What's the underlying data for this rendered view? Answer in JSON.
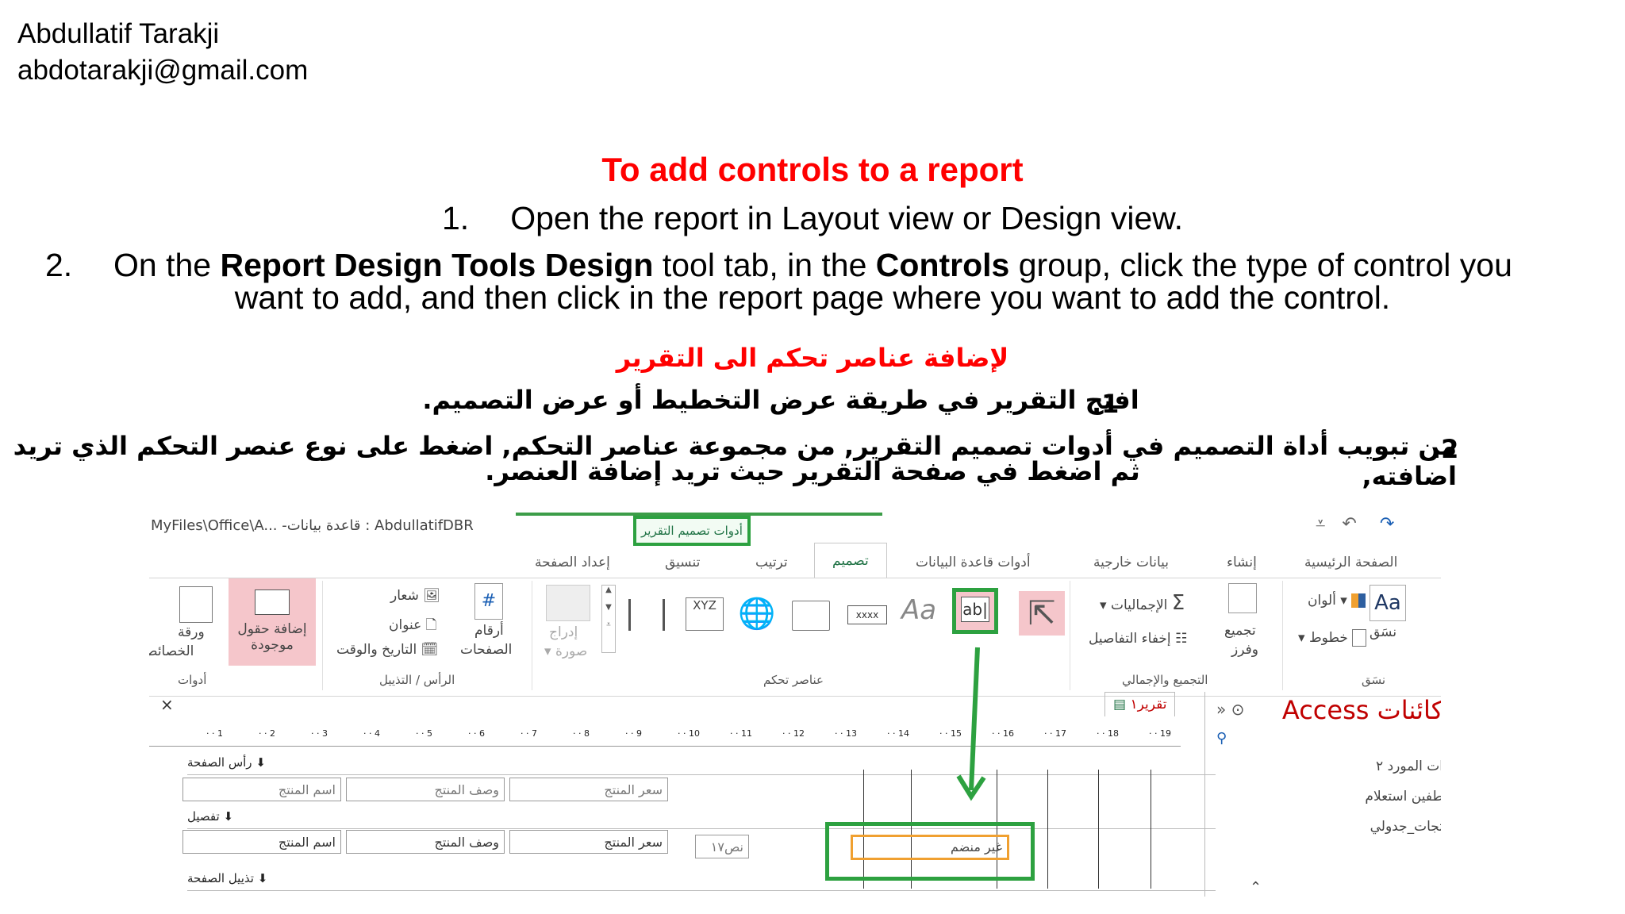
{
  "author": {
    "name": "Abdullatif Tarakji",
    "email": "abdotarakji@gmail.com"
  },
  "english": {
    "title": "To add controls to a report",
    "step1_num": "1.",
    "step1_text": "Open the report in Layout view or Design view.",
    "step2_num": "2.",
    "step2_part1": "On the ",
    "step2_bold1": "Report Design Tools Design",
    "step2_part2": " tool tab, in the ",
    "step2_bold2": "Controls",
    "step2_part3": " group, click the type of control you",
    "step2_line2": "want to add, and then click in the report page where you want to add the control."
  },
  "arabic": {
    "title": "لإضافة عناصر تحكم الى التقرير",
    "step1_num": ".1",
    "step1_text": "افتح التقرير في طريقة عرض التخطيط أو عرض التصميم.",
    "step2_num": ".2",
    "step2_line1": "من تبويب أداة التصميم في أدوات تصميم التقرير, من مجموعة عناصر التحكم, اضغط على نوع عنصر التحكم الذي تريد اضافته,",
    "step2_line2": "ثم اضغط في صفحة التقرير حيث تريد إضافة العنصر."
  },
  "screenshot": {
    "window_title": "MyFiles\\Office\\A... -قاعدة بيانات : AbdullatifDBR",
    "context_tab": "أدوات تصميم التقرير",
    "tabs": [
      "الصفحة الرئيسية",
      "إنشاء",
      "بيانات خارجية",
      "أدوات قاعدة البيانات",
      "تصميم",
      "ترتيب",
      "تنسيق",
      "إعداد الصفحة"
    ],
    "active_tab": "تصميم",
    "groups": {
      "themes": "نسَق",
      "grouping": "التجميع والإجمالي",
      "controls": "عناصر تحكم",
      "header_footer": "الرأس / التذييل",
      "tools": "أدوات"
    },
    "buttons": {
      "themes": "نسَق",
      "colors": "ألوان",
      "fonts": "خطوط",
      "group_sort_1": "تجميع",
      "group_sort_2": "وفرز",
      "totals": "الإجماليات",
      "hide_details": "إخفاء التفاصيل",
      "insert_image_1": "إدراج",
      "insert_image_2": "صورة",
      "page_numbers_1": "أرقام",
      "page_numbers_2": "الصفحات",
      "logo": "شعار",
      "title": "عنوان",
      "date_time": "التاريخ والوقت",
      "add_fields_1": "إضافة حقول",
      "add_fields_2": "موجودة",
      "property_sheet_1": "ورقة",
      "property_sheet_2": "الخصائص",
      "label_control": "Aa",
      "textbox_control": "ab|",
      "xyz": "XYZ",
      "xxxx": "xxxx"
    },
    "doc_tab": "تقرير١",
    "close": "×",
    "ruler_numbers": [
      "1",
      "2",
      "3",
      "4",
      "5",
      "6",
      "7",
      "8",
      "9",
      "10",
      "11",
      "12",
      "13",
      "14",
      "15",
      "16",
      "17",
      "18",
      "19"
    ],
    "sections": {
      "page_header": "رأس الصفحة",
      "detail": "تفصيل",
      "page_footer": "تذييل الصفحة"
    },
    "header_fields": [
      "اسم المنتج",
      "وصف المنتج",
      "سعر المنتج"
    ],
    "header_fields_ghost": [
      "اسم المنتج",
      "وصف المنتج",
      "سعر المنتج"
    ],
    "detail_fields": [
      "اسم المنتج",
      "وصف المنتج",
      "سعر المنتج"
    ],
    "small_field": "نص١٧",
    "new_textbox": "غير منضم",
    "nav_pane": {
      "title": "Access كائنات",
      "items": [
        "ات المورد ٢",
        "طفين استعلام",
        "تجات_جدولي"
      ]
    },
    "colors": {
      "green": "#2da140",
      "accent": "#217346",
      "pink": "#f5c6cb",
      "orange": "#f0a030"
    }
  }
}
